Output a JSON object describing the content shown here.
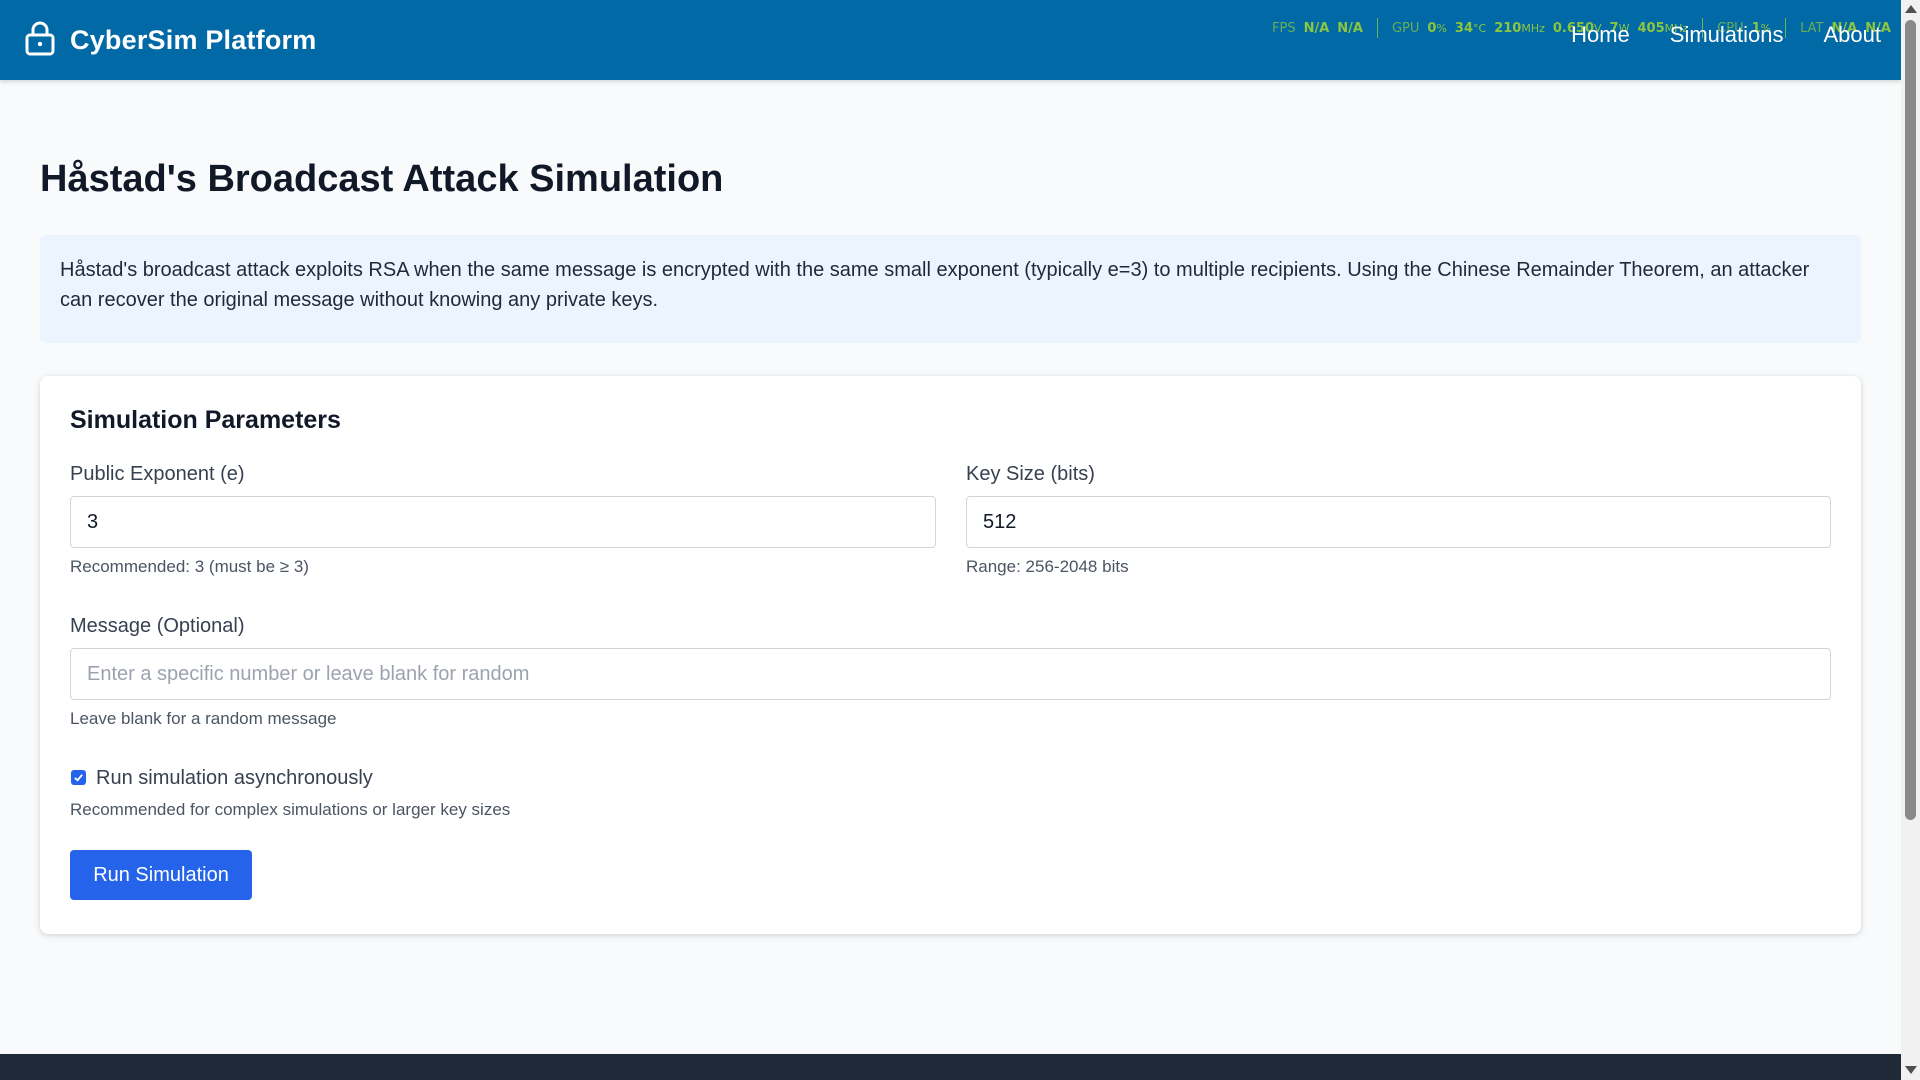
{
  "header": {
    "brand": "CyberSim Platform",
    "brand_icon": "lock-icon",
    "nav": [
      "Home",
      "Simulations",
      "About"
    ]
  },
  "overlay": {
    "fps": {
      "label": "FPS",
      "v1": "N/A",
      "v2": "N/A"
    },
    "gpu": {
      "label": "GPU",
      "usage": "0",
      "usage_unit": "%",
      "temp": "34",
      "temp_unit": "°C",
      "clock": "210",
      "clock_unit": "MHz",
      "volt": "0.650",
      "volt_unit": "V",
      "power": "7",
      "power_unit": "W",
      "mem": "405",
      "mem_unit": "MHz"
    },
    "cpu": {
      "label": "CPU",
      "usage": "1",
      "usage_unit": "%"
    },
    "lat": {
      "label": "LAT",
      "v1": "N/A",
      "v2": "N/A"
    }
  },
  "page": {
    "title": "Håstad's Broadcast Attack Simulation",
    "description": "Håstad's broadcast attack exploits RSA when the same message is encrypted with the same small exponent (typically e=3) to multiple recipients. Using the Chinese Remainder Theorem, an attacker can recover the original message without knowing any private keys."
  },
  "form": {
    "heading": "Simulation Parameters",
    "exponent": {
      "label": "Public Exponent (e)",
      "value": "3",
      "help": "Recommended: 3 (must be ≥ 3)"
    },
    "keysize": {
      "label": "Key Size (bits)",
      "value": "512",
      "help": "Range: 256-2048 bits"
    },
    "message": {
      "label": "Message (Optional)",
      "value": "",
      "placeholder": "Enter a specific number or leave blank for random",
      "help": "Leave blank for a random message"
    },
    "async": {
      "label": "Run simulation asynchronously",
      "checked": true,
      "help": "Recommended for complex simulations or larger key sizes"
    },
    "submit": "Run Simulation"
  },
  "colors": {
    "header": "#0069a6",
    "accent": "#2563eb",
    "info_bg": "#ebf4ff",
    "footer": "#1f2937",
    "overlay": "#8cc63f"
  }
}
